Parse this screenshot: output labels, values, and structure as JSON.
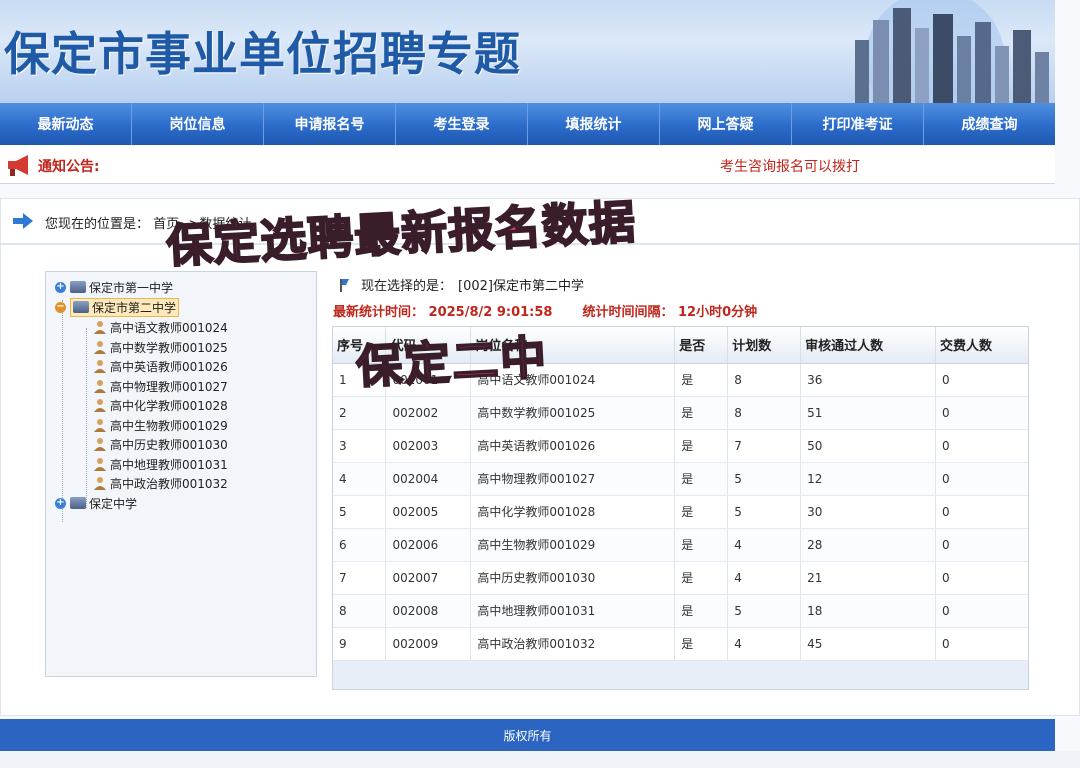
{
  "site": {
    "title": "保定市事业单位招聘专题"
  },
  "nav": [
    "最新动态",
    "岗位信息",
    "申请报名号",
    "考生登录",
    "填报统计",
    "网上答疑",
    "打印准考证",
    "成绩查询"
  ],
  "notice": {
    "label": "通知公告:",
    "marquee": "考生咨询报名可以拨打"
  },
  "breadcrumb": {
    "text": "您现在的位置是：  首页-->数据统计"
  },
  "tree": {
    "school1": "保定市第一中学",
    "school2": "保定市第二中学",
    "school3": "保定中学",
    "positions": [
      "高中语文教师001024",
      "高中数学教师001025",
      "高中英语教师001026",
      "高中物理教师001027",
      "高中化学教师001028",
      "高中生物教师001029",
      "高中历史教师001030",
      "高中地理教师001031",
      "高中政治教师001032"
    ]
  },
  "selection": {
    "label": "现在选择的是：",
    "value": "[002]保定市第二中学"
  },
  "stats": {
    "time": "最新统计时间：  2025/8/2 9:01:58",
    "interval": "统计时间间隔：  12小时0分钟"
  },
  "table": {
    "headers": [
      "序号",
      "代码",
      "岗位名称",
      "是否",
      "计划数",
      "审核通过人数",
      "交费人数"
    ],
    "rows": [
      [
        "1",
        "002001",
        "高中语文教师001024",
        "是",
        "8",
        "36",
        "0"
      ],
      [
        "2",
        "002002",
        "高中数学教师001025",
        "是",
        "8",
        "51",
        "0"
      ],
      [
        "3",
        "002003",
        "高中英语教师001026",
        "是",
        "7",
        "50",
        "0"
      ],
      [
        "4",
        "002004",
        "高中物理教师001027",
        "是",
        "5",
        "12",
        "0"
      ],
      [
        "5",
        "002005",
        "高中化学教师001028",
        "是",
        "5",
        "30",
        "0"
      ],
      [
        "6",
        "002006",
        "高中生物教师001029",
        "是",
        "4",
        "28",
        "0"
      ],
      [
        "7",
        "002007",
        "高中历史教师001030",
        "是",
        "4",
        "21",
        "0"
      ],
      [
        "8",
        "002008",
        "高中地理教师001031",
        "是",
        "5",
        "18",
        "0"
      ],
      [
        "9",
        "002009",
        "高中政治教师001032",
        "是",
        "4",
        "45",
        "0"
      ]
    ]
  },
  "footer": {
    "text": "版权所有"
  },
  "overlay": {
    "line1": "保定选聘最新报名数据",
    "line2": "保定二中"
  }
}
